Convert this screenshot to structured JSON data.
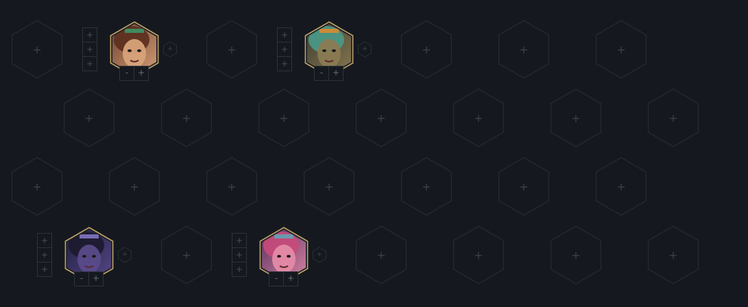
{
  "board": {
    "empty_slot_icon": "+",
    "colors": {
      "background": "#15191f",
      "hex_outline": "#252a30",
      "champion_border": "#c2a46a"
    }
  },
  "units": [
    {
      "name": "",
      "portrait": "red-haired-warrior-portrait",
      "items": [
        "+",
        "+",
        "+"
      ],
      "star_down": "-",
      "star_up": "+",
      "extra": "+",
      "palette": {
        "bg1": "#6b3d2a",
        "bg2": "#d8a27a",
        "accent": "#3a9a6a",
        "hair": "#5a2e1e"
      }
    },
    {
      "name": "",
      "portrait": "stone-golem-portrait",
      "items": [
        "+",
        "+",
        "+"
      ],
      "star_down": "-",
      "star_up": "+",
      "extra": "+",
      "palette": {
        "bg1": "#3b3a2e",
        "bg2": "#8a7a52",
        "accent": "#e58a2a",
        "hair": "#4a9a8a"
      }
    },
    {
      "name": "",
      "portrait": "dark-haired-hero-portrait",
      "items": [
        "+",
        "+",
        "+"
      ],
      "star_down": "-",
      "star_up": "+",
      "extra": "+",
      "palette": {
        "bg1": "#1a1c3a",
        "bg2": "#5a4a8a",
        "accent": "#8a7ac8",
        "hair": "#1c1a2e"
      }
    },
    {
      "name": "",
      "portrait": "pink-yordle-portrait",
      "items": [
        "+",
        "+",
        "+"
      ],
      "star_down": "-",
      "star_up": "+",
      "extra": "+",
      "palette": {
        "bg1": "#4a2a5a",
        "bg2": "#e48aa8",
        "accent": "#5aa8b8",
        "hair": "#c84a7a"
      }
    }
  ]
}
